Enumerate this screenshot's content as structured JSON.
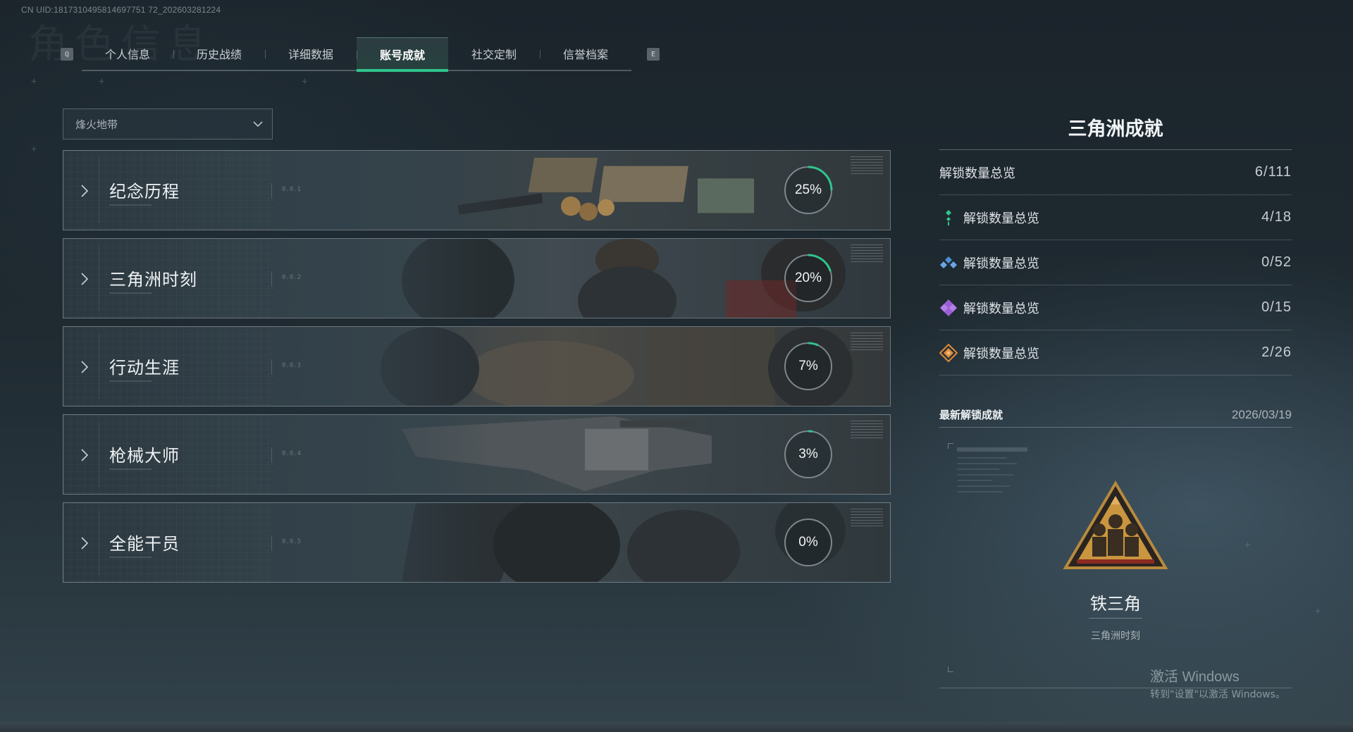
{
  "uid_text": "CN UID:1817310495814697751 72_202603281224",
  "background_title": "角色信息",
  "tabs": {
    "left_key": "Q",
    "right_key": "E",
    "items": [
      {
        "label": "个人信息"
      },
      {
        "label": "历史战绩"
      },
      {
        "label": "详细数据"
      },
      {
        "label": "账号成就"
      },
      {
        "label": "社交定制"
      },
      {
        "label": "信誉档案"
      }
    ],
    "active_index": 3
  },
  "mode_dropdown": {
    "selected": "烽火地带"
  },
  "categories": [
    {
      "title": "纪念历程",
      "number": "0.0.1",
      "progress_label": "25%",
      "progress": 0.25
    },
    {
      "title": "三角洲时刻",
      "number": "0.0.2",
      "progress_label": "20%",
      "progress": 0.2
    },
    {
      "title": "行动生涯",
      "number": "0.0.3",
      "progress_label": "7%",
      "progress": 0.07
    },
    {
      "title": "枪械大师",
      "number": "0.0.4",
      "progress_label": "3%",
      "progress": 0.03
    },
    {
      "title": "全能干员",
      "number": "0.0.5",
      "progress_label": "0%",
      "progress": 0.0
    }
  ],
  "summary": {
    "title": "三角洲成就",
    "total": {
      "label": "解锁数量总览",
      "value": "6/111"
    },
    "tiers": [
      {
        "label": "解锁数量总览",
        "value": "4/18",
        "icon": "green-tier-icon",
        "color": "#2fc58c"
      },
      {
        "label": "解锁数量总览",
        "value": "0/52",
        "icon": "blue-tier-icon",
        "color": "#4a8fd6"
      },
      {
        "label": "解锁数量总览",
        "value": "0/15",
        "icon": "purple-tier-icon",
        "color": "#9a5fd4"
      },
      {
        "label": "解锁数量总览",
        "value": "2/26",
        "icon": "orange-tier-icon",
        "color": "#e08a3a"
      }
    ]
  },
  "latest": {
    "label": "最新解锁成就",
    "date": "2026/03/19",
    "achievement_name": "铁三角",
    "achievement_category": "三角洲时刻",
    "badge_icon": "iron-triangle-badge-icon"
  },
  "watermark": {
    "line1": "激活 Windows",
    "line2": "转到\"设置\"以激活 Windows。"
  },
  "colors": {
    "accent": "#2fc58c",
    "ring_track": "#7d878d"
  }
}
